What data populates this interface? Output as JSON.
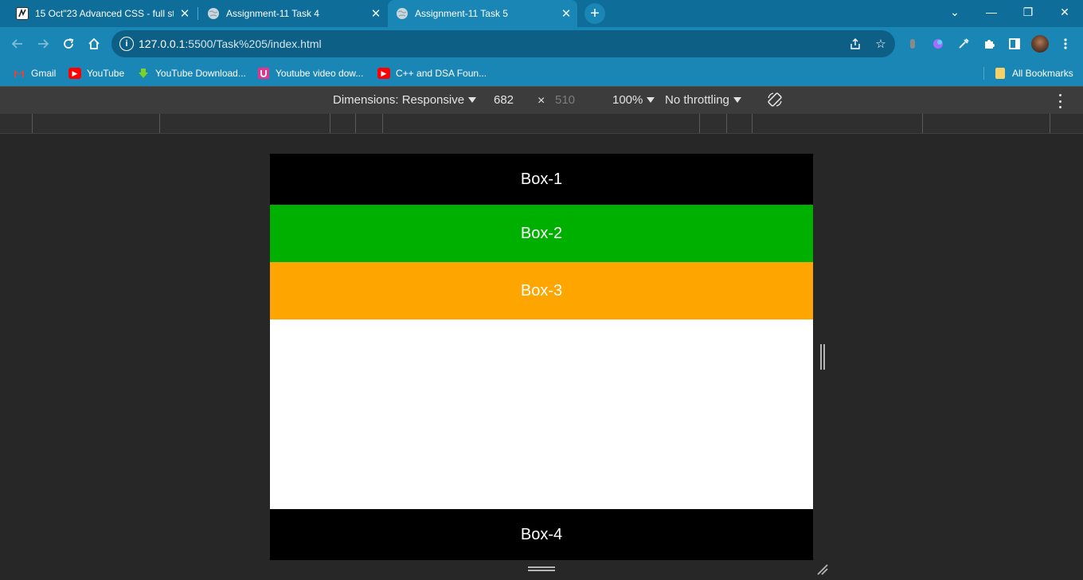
{
  "browser": {
    "tabs": [
      {
        "title": "15 Oct\"23 Advanced CSS - full st",
        "active": false
      },
      {
        "title": "Assignment-11 Task 4",
        "active": false
      },
      {
        "title": "Assignment-11 Task 5",
        "active": true
      }
    ],
    "new_tab_symbol": "+",
    "window_controls": {
      "tab_search": "⌄",
      "minimize": "—",
      "restore": "❐",
      "close": "✕"
    },
    "url_host": "127.0.0.1",
    "url_path": ":5500/Task%205/index.html",
    "bookmarks": [
      {
        "label": "Gmail",
        "icon": "gmail-icon"
      },
      {
        "label": "YouTube",
        "icon": "youtube-icon"
      },
      {
        "label": "YouTube Download...",
        "icon": "download-icon"
      },
      {
        "label": "Youtube video dow...",
        "icon": "u-icon"
      },
      {
        "label": "C++ and DSA Foun...",
        "icon": "youtube-icon"
      }
    ],
    "all_bookmarks": "All Bookmarks"
  },
  "devtools": {
    "dimensions_label": "Dimensions: Responsive",
    "width": "682",
    "times": "×",
    "height": "510",
    "zoom": "100%",
    "throttling": "No throttling"
  },
  "page": {
    "boxes": [
      {
        "label": "Box-1",
        "color": "#000000"
      },
      {
        "label": "Box-2",
        "color": "#00b000"
      },
      {
        "label": "Box-3",
        "color": "#ffa500"
      },
      {
        "label": "Box-4",
        "color": "#000000"
      }
    ],
    "background": "#ffffff"
  },
  "colors": {
    "tabbar": "#0e6d99",
    "toolbar": "#1a86b5",
    "devbar": "#3c3c3c",
    "canvas": "#272727"
  }
}
